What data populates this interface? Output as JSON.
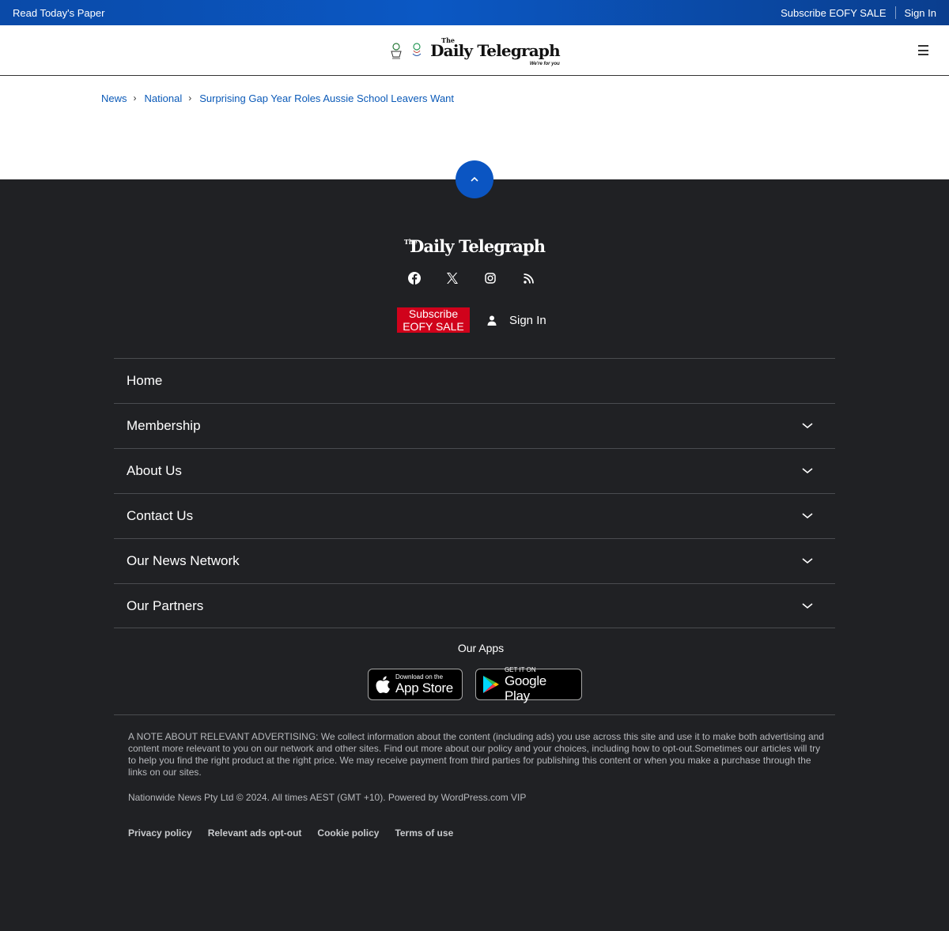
{
  "topbar": {
    "read_paper": "Read Today's Paper",
    "subscribe": "Subscribe EOFY SALE",
    "sign_in": "Sign In"
  },
  "header": {
    "masthead_the": "The",
    "masthead": "Daily Telegraph",
    "tagline": "We're for you",
    "menu_icon": "hamburger-icon"
  },
  "breadcrumb": {
    "items": [
      "News",
      "National",
      "Surprising Gap Year Roles Aussie School Leavers Want"
    ]
  },
  "footer": {
    "back_to_top_icon": "chevron-up-icon",
    "logo_the": "The",
    "logo": "Daily Telegraph",
    "socials": [
      "facebook-icon",
      "x-icon",
      "instagram-icon",
      "rss-icon"
    ],
    "subscribe_line1": "Subscribe",
    "subscribe_line2": "EOFY SALE",
    "sign_in": "Sign In",
    "nav": [
      {
        "label": "Home",
        "expandable": false
      },
      {
        "label": "Membership",
        "expandable": true
      },
      {
        "label": "About Us",
        "expandable": true
      },
      {
        "label": "Contact Us",
        "expandable": true
      },
      {
        "label": "Our News Network",
        "expandable": true
      },
      {
        "label": "Our Partners",
        "expandable": true
      }
    ],
    "apps_title": "Our Apps",
    "app_store": {
      "small": "Download on the",
      "big": "App Store"
    },
    "google_play": {
      "small": "GET IT ON",
      "big": "Google Play"
    },
    "note": "A NOTE ABOUT RELEVANT ADVERTISING: We collect information about the content (including ads) you use across this site and use it to make both advertising and content more relevant to you on our network and other sites. Find out more about our policy and your choices, including how to opt-out.Sometimes our articles will try to help you find the right product at the right price. We may receive payment from third parties for publishing this content or when you make a purchase through the links on our sites.",
    "copyright": "Nationwide News Pty Ltd © 2024. All times AEST (GMT +10). Powered by WordPress.com VIP",
    "legal": [
      "Privacy policy",
      "Relevant ads opt-out",
      "Cookie policy",
      "Terms of use"
    ]
  },
  "colors": {
    "topbar_blue": "#0b58c4",
    "footer_bg": "#202124",
    "subscribe_red": "#d0021b",
    "link_blue": "#0b5ab8"
  }
}
